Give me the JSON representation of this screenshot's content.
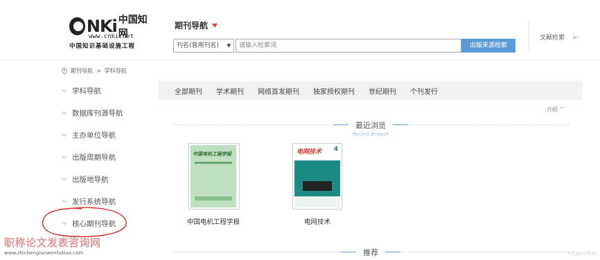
{
  "header": {
    "logo": {
      "brand": "NKi",
      "brand_cn": "中国知网",
      "url": "www.cnki.net",
      "subtitle": "中国知识基础设施工程"
    },
    "nav_title": "期刊导航",
    "search": {
      "select_value": "刊名(曾用刊名)",
      "placeholder": "请输入检索词",
      "button_label": "出版来源检索"
    },
    "lit_search_label": "文献检索",
    "lit_search_chevron": ">"
  },
  "breadcrumb": {
    "items": [
      "期刊导航",
      "学科导航"
    ],
    "separator": ">"
  },
  "sidebar": {
    "items": [
      {
        "label": "学科导航"
      },
      {
        "label": "数据库刊源导航"
      },
      {
        "label": "主办单位导航"
      },
      {
        "label": "出版周期导航"
      },
      {
        "label": "出版地导航"
      },
      {
        "label": "发行系统导航"
      },
      {
        "label": "核心期刊导航"
      }
    ]
  },
  "tabs": [
    {
      "label": "全部期刊"
    },
    {
      "label": "学术期刊"
    },
    {
      "label": "网络首发期刊"
    },
    {
      "label": "独家授权期刊"
    },
    {
      "label": "世纪期刊"
    },
    {
      "label": "个刊发行"
    }
  ],
  "intro_label": "介绍 ﹀",
  "recent_section": {
    "title": "最近浏览",
    "subtitle": "Recent Browse"
  },
  "journals": [
    {
      "name": "中国电机工程学报",
      "cover_text": "中国电机工程学报"
    },
    {
      "name": "电网技术",
      "cover_text": "电网技术",
      "cover_number": "4"
    }
  ],
  "recommend_section": {
    "title": "推荐"
  },
  "watermark": {
    "text": "职称论文发表咨询网",
    "url": "www.zhichenglunwenfabiao.com",
    "right_text": "https://blo"
  },
  "colors": {
    "accent_blue": "#5b9cd6",
    "caret_red": "#e0413a",
    "annotation_red": "#d42a2a"
  }
}
